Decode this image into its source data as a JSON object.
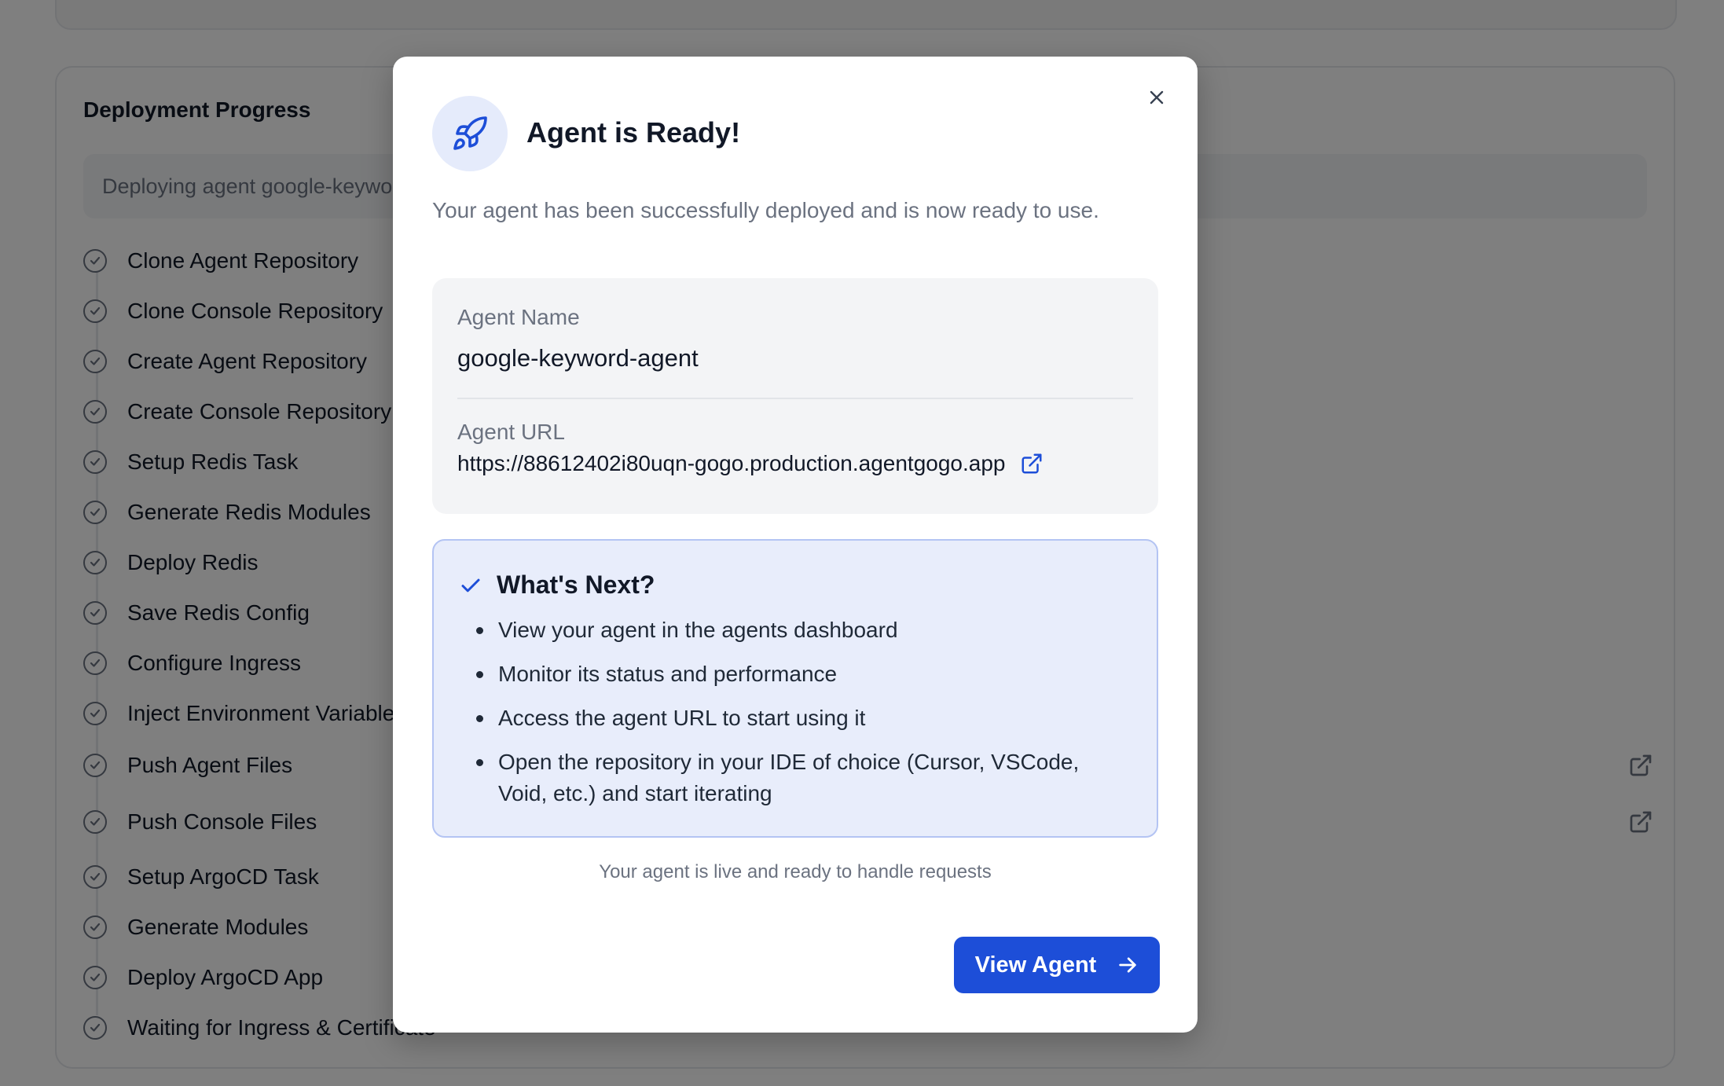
{
  "background": {
    "progress_title": "Deployment Progress",
    "status_text": "Deploying agent google-keyword-agent...",
    "steps": [
      {
        "label": "Clone Agent Repository"
      },
      {
        "label": "Clone Console Repository"
      },
      {
        "label": "Create Agent Repository"
      },
      {
        "label": "Create Console Repository"
      },
      {
        "label": "Setup Redis Task"
      },
      {
        "label": "Generate Redis Modules"
      },
      {
        "label": "Deploy Redis"
      },
      {
        "label": "Save Redis Config"
      },
      {
        "label": "Configure Ingress"
      },
      {
        "label": "Inject Environment Variables"
      },
      {
        "label": "Push Agent Files"
      },
      {
        "label": "Push Console Files"
      },
      {
        "label": "Setup ArgoCD Task"
      },
      {
        "label": "Generate Modules"
      },
      {
        "label": "Deploy ArgoCD App"
      },
      {
        "label": "Waiting for Ingress & Certificate"
      }
    ]
  },
  "modal": {
    "title": "Agent is Ready!",
    "subtitle": "Your agent has been successfully deployed and is now ready to use.",
    "agent_name_label": "Agent Name",
    "agent_name_value": "google-keyword-agent",
    "agent_url_label": "Agent URL",
    "agent_url_value": "https://88612402i80uqn-gogo.production.agentgogo.app",
    "next_title": "What's Next?",
    "next_items": [
      "View your agent in the agents dashboard",
      "Monitor its status and performance",
      "Access the agent URL to start using it",
      "Open the repository in your IDE of choice (Cursor, VSCode, Void, etc.) and start iterating"
    ],
    "live_text": "Your agent is live and ready to handle requests",
    "view_button_label": "View Agent"
  },
  "colors": {
    "accent": "#1d4ed8",
    "next_box_bg": "#e8edfb",
    "overlay": "rgba(0,0,0,0.5)"
  },
  "icons": {
    "rocket": "rocket-icon",
    "close": "close-icon",
    "external_link": "external-link-icon",
    "check": "check-icon",
    "arrow_right": "arrow-right-icon",
    "step_check": "check-circle-icon"
  }
}
